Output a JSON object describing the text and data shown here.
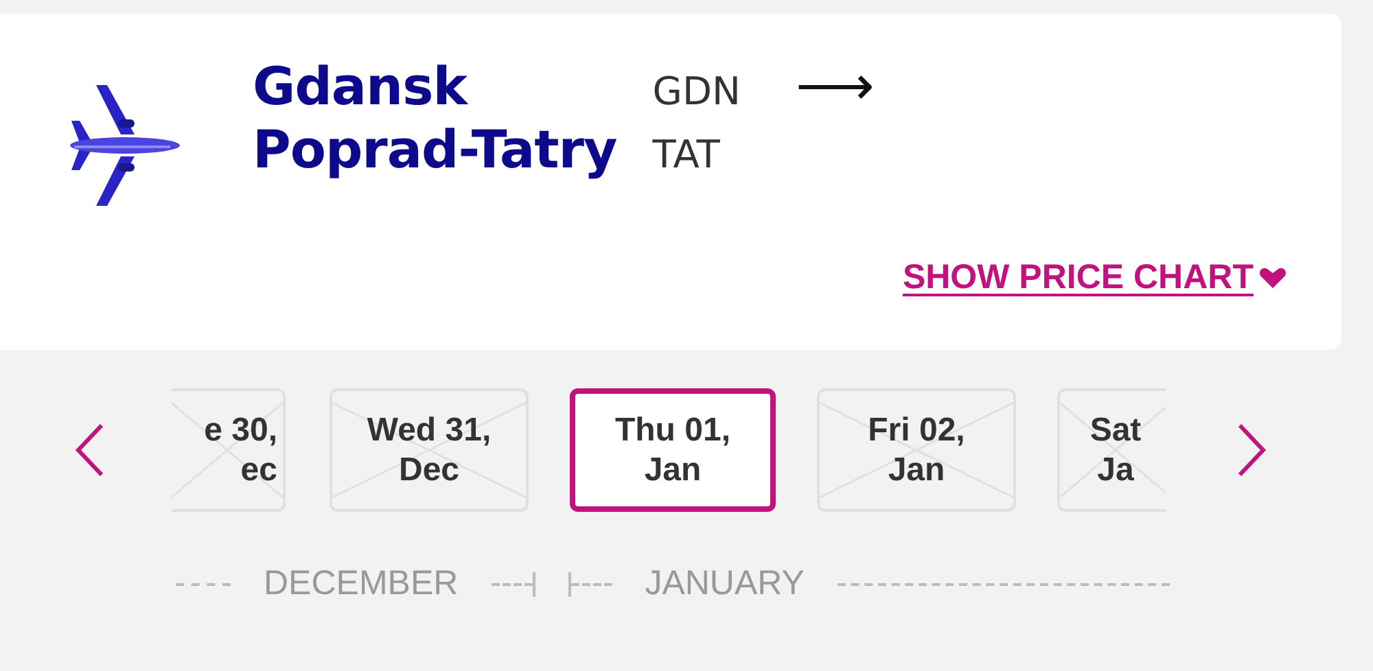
{
  "route": {
    "origin": {
      "city": "Gdansk",
      "code": "GDN"
    },
    "destination": {
      "city": "Poprad-Tatry",
      "code": "TAT"
    },
    "arrow": "⟶"
  },
  "price_chart_link": {
    "label": "SHOW PRICE CHART"
  },
  "date_strip": {
    "dates": [
      {
        "line1": "e 30,",
        "line2": "ec",
        "selected": false,
        "disabled": true,
        "kind": "cut_left"
      },
      {
        "line1": "Wed 31,",
        "line2": "Dec",
        "selected": false,
        "disabled": true,
        "kind": "full"
      },
      {
        "line1": "Thu 01,",
        "line2": "Jan",
        "selected": true,
        "disabled": false,
        "kind": "full"
      },
      {
        "line1": "Fri 02,",
        "line2": "Jan",
        "selected": false,
        "disabled": true,
        "kind": "full"
      },
      {
        "line1": "Sat",
        "line2": "Ja",
        "selected": false,
        "disabled": true,
        "kind": "cut_right"
      }
    ],
    "months": [
      "DECEMBER",
      "JANUARY"
    ]
  }
}
